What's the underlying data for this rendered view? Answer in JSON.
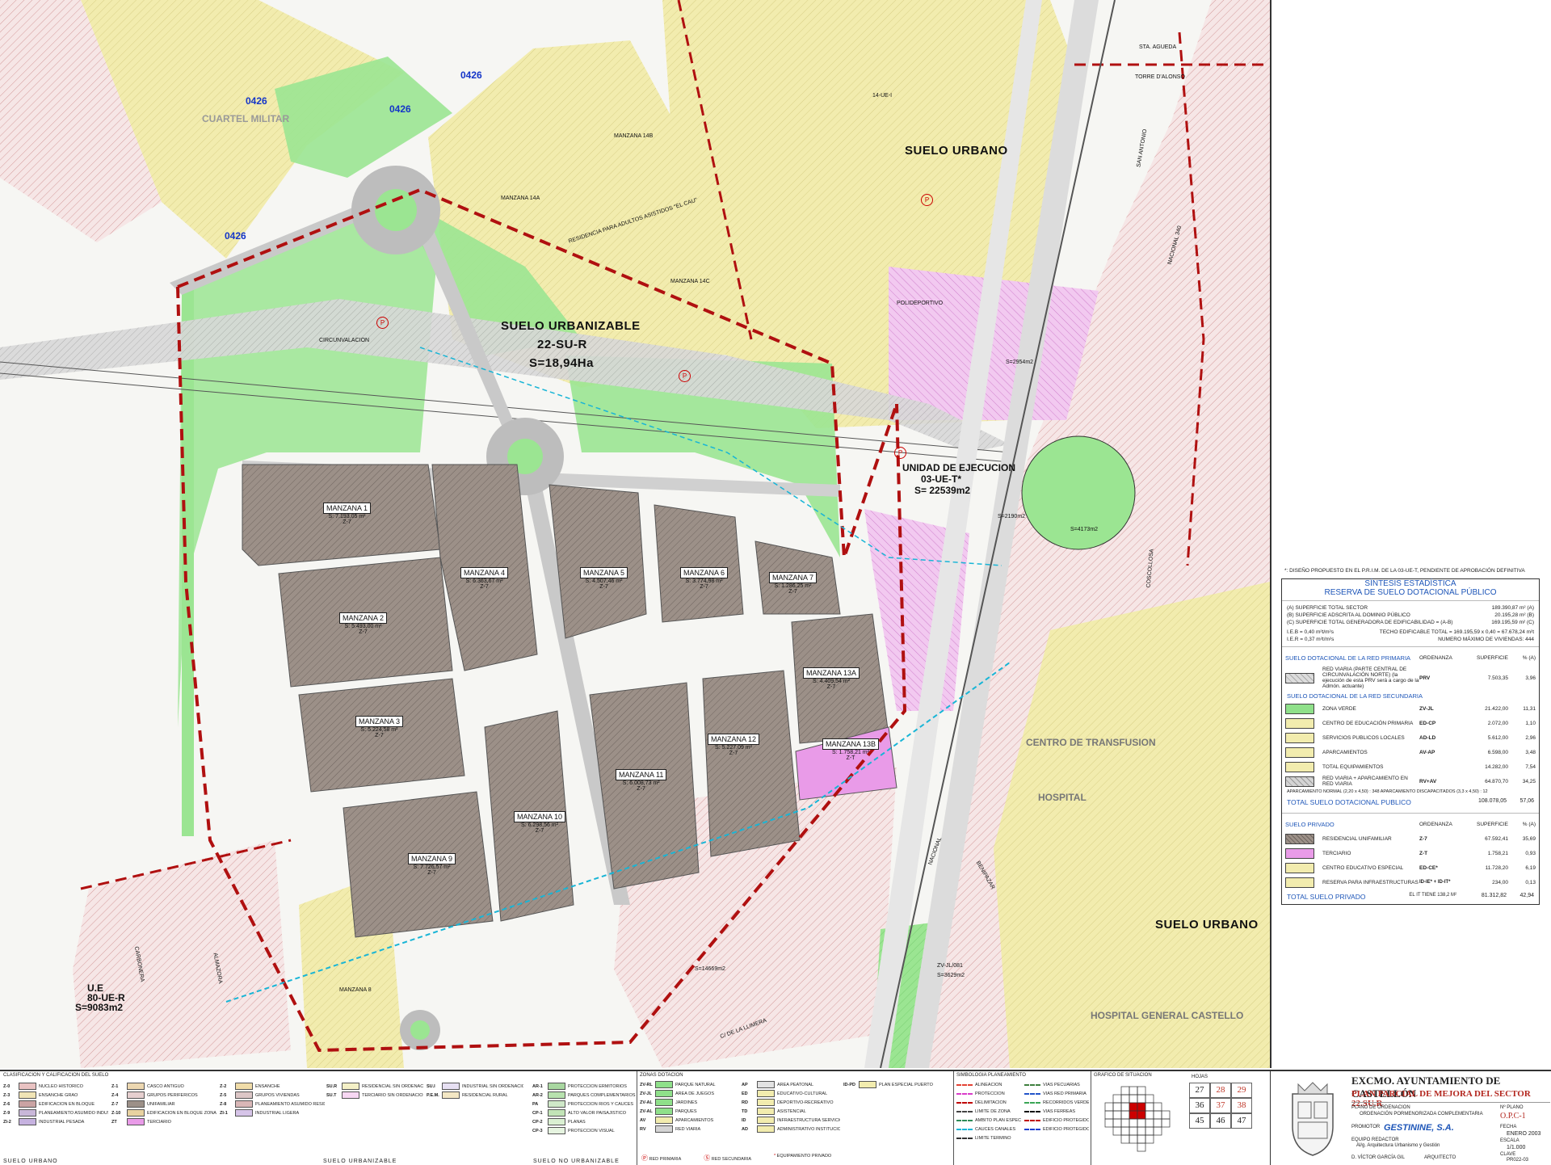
{
  "map": {
    "zone_labels": [
      {
        "text": "SUELO URBANO",
        "cls": "big"
      },
      {
        "text": "SUELO URBANIZABLE",
        "cls": "big"
      },
      {
        "text": "22-SU-R",
        "cls": "big"
      },
      {
        "text": "S=18,94Ha",
        "cls": "big"
      },
      {
        "text": "UNIDAD DE EJECUCION",
        "cls": "med"
      },
      {
        "text": "03-UE-T*",
        "cls": "med"
      },
      {
        "text": "S= 22539m2",
        "cls": "med"
      },
      {
        "text": "SUELO URBANO",
        "cls": "big"
      },
      {
        "text": "U.E",
        "cls": "med"
      },
      {
        "text": "80-UE-R",
        "cls": "med"
      },
      {
        "text": "S=9083m2",
        "cls": "med"
      },
      {
        "text": "CUARTEL MILITAR",
        "cls": "med"
      },
      {
        "text": "CIRCUNVALACION",
        "cls": "small"
      },
      {
        "text": "14-UE-I",
        "cls": "small"
      },
      {
        "text": "POLIDEPORTIVO",
        "cls": "small"
      },
      {
        "text": "CENTRO DE TRANSFUSION",
        "cls": "med"
      },
      {
        "text": "HOSPITAL",
        "cls": "med"
      },
      {
        "text": "HOSPITAL GENERAL CASTELLO",
        "cls": "med"
      },
      {
        "text": "NACIONAL 340",
        "cls": "small"
      },
      {
        "text": "NACIONAL",
        "cls": "small"
      },
      {
        "text": "COSCOLLOSA",
        "cls": "small"
      },
      {
        "text": "BENIPAZAR",
        "cls": "small"
      },
      {
        "text": "C/ DE LA LLIMERA",
        "cls": "small"
      },
      {
        "text": "STA. AGUEDA",
        "cls": "small"
      },
      {
        "text": "TORRE D'ALONSO",
        "cls": "small"
      },
      {
        "text": "SAN ANTONIO",
        "cls": "small"
      },
      {
        "text": "ALMAZORA",
        "cls": "small"
      },
      {
        "text": "CARBONERA",
        "cls": "small"
      },
      {
        "text": "RESIDENCIA PARA ADULTOS ASISTIDOS \"EL CAU\"",
        "cls": "small"
      },
      {
        "text": "MANZANA 14A",
        "cls": "small"
      },
      {
        "text": "MANZANA 14B",
        "cls": "small"
      },
      {
        "text": "MANZANA 14C",
        "cls": "small"
      },
      {
        "text": "MANZANA 8",
        "cls": "small"
      },
      {
        "text": "ZV-JL/081",
        "cls": "small"
      },
      {
        "text": "S=3629m2",
        "cls": "small"
      },
      {
        "text": "S=2954m2",
        "cls": "small"
      },
      {
        "text": "S=4173m2",
        "cls": "small"
      },
      {
        "text": "S=2190m2",
        "cls": "small"
      },
      {
        "text": "S=14669m2",
        "cls": "small"
      }
    ],
    "manzanas": [
      {
        "name": "MANZANA 1",
        "area": "S: 7.193,05 m²",
        "zone": "Z-7"
      },
      {
        "name": "MANZANA 2",
        "area": "S: 5.493,00 m²",
        "zone": "Z-7"
      },
      {
        "name": "MANZANA 3",
        "area": "S: 5.224,58 m²",
        "zone": "Z-7"
      },
      {
        "name": "MANZANA 4",
        "area": "S: 6.363,67 m²",
        "zone": "Z-7"
      },
      {
        "name": "MANZANA 5",
        "area": "S: 4.507,46 m²",
        "zone": "Z-7"
      },
      {
        "name": "MANZANA 6",
        "area": "S: 3.774,98 m²",
        "zone": "Z-7"
      },
      {
        "name": "MANZANA 7",
        "area": "S: 1.286,25 m²",
        "zone": "Z-7"
      },
      {
        "name": "MANZANA 9",
        "area": "S: 7.726,57 m²",
        "zone": "Z-7"
      },
      {
        "name": "MANZANA 10",
        "area": "S: 6.298,56 m²",
        "zone": "Z-7"
      },
      {
        "name": "MANZANA 11",
        "area": "S: 6.008,73 m²",
        "zone": "Z-7"
      },
      {
        "name": "MANZANA 12",
        "area": "S: 5.227,09 m²",
        "zone": "Z-7"
      },
      {
        "name": "MANZANA 13A",
        "area": "S: 4.409,54 m²",
        "zone": "Z-7"
      },
      {
        "name": "MANZANA 13B",
        "area": "S: 1.758,21 m²",
        "zone": "Z-T"
      }
    ],
    "blue_codes": [
      "0426",
      "0426",
      "0426",
      "0426"
    ]
  },
  "legend": {
    "footnote": "*: DISEÑO PROPUESTO EN EL P.R.I.M. DE LA 03-UE-T, PENDIENTE DE APROBACIÓN DEFINITIVA",
    "title1": "SÍNTESIS ESTADÍSTICA",
    "title2": "RESERVA DE SUELO DOTACIONAL PÚBLICO",
    "summary": [
      {
        "label": "(A) SUPERFICIE TOTAL SECTOR",
        "value": "189.390,87 m² (A)"
      },
      {
        "label": "(B) SUPERFICIE ADSCRITA AL DOMINIO PÚBLICO",
        "value": "20.195,28 m² (B)"
      },
      {
        "label": "(C) SUPERFICIE TOTAL GENERADORA DE EDIFICABILIDAD = (A-B)",
        "value": "169.195,59 m² (C)"
      }
    ],
    "indices": [
      {
        "label": "I.E.B = 0,40 m²t/m²s",
        "value": "TECHO EDIFICABLE TOTAL = 169.195,59 x 0,40 = 67.678,24 m²t"
      },
      {
        "label": "I.E.R = 0,37 m²t/m²s",
        "value": "NUMERO MÁXIMO DE VIVIENDAS: 444"
      }
    ],
    "primary_header": "SUELO DOTACIONAL DE LA RED PRIMARIA",
    "col_ordenanza": "ORDENANZA",
    "col_superficie": "SUPERFICIE",
    "col_pct": "% (A)",
    "primary_rows": [
      {
        "name": "RED VIARIA (PARTE CENTRAL DE CIRCUNVALACIÓN NORTE) (la ejecución de esta PRV será a cargo de la Admón. actuante)",
        "code": "PRV",
        "value": "7.503,35",
        "pct": "3,96",
        "color": "#dcdcdc"
      }
    ],
    "secondary_header": "SUELO DOTACIONAL DE LA RED SECUNDARIA",
    "secondary_rows": [
      {
        "name": "ZONA VERDE",
        "code": "ZV-JL",
        "value": "21.422,00",
        "pct": "11,31",
        "color": "#8fe08a"
      },
      {
        "name": "CENTRO DE EDUCACIÓN PRIMARIA",
        "code": "ED-CP",
        "value": "2.072,00",
        "pct": "1,10",
        "color": "#f2ecae"
      },
      {
        "name": "SERVICIOS PUBLICOS LOCALES",
        "code": "AD-LD",
        "value": "5.612,00",
        "pct": "2,96",
        "color": "#f2ecae"
      },
      {
        "name": "APARCAMIENTOS",
        "code": "AV-AP",
        "value": "6.598,00",
        "pct": "3,48",
        "color": "#f2ecae"
      },
      {
        "name": "TOTAL EQUIPAMIENTOS",
        "code": "",
        "value": "14.282,00",
        "pct": "7,54",
        "color": "#f2ecae"
      },
      {
        "name": "RED VIARIA + APARCAMIENTO EN RED VIARIA",
        "code": "RV+AV",
        "value": "64.870,70",
        "pct": "34,25",
        "color": "#d4d4d4"
      }
    ],
    "parking_note": "APARCAMIENTO NORMAL (2,20 x 4,50) : 348    APARCAMIENTO DISCAPACITADOS (3,3 x 4,50) : 12",
    "total_public_label": "TOTAL SUELO DOTACIONAL PUBLICO",
    "total_public_value": "108.078,05",
    "total_public_pct": "57,06",
    "private_header": "SUELO PRIVADO",
    "private_rows": [
      {
        "name": "RESIDENCIAL UNIFAMILIAR",
        "code": "Z-7",
        "value": "67.592,41",
        "pct": "35,69",
        "color": "#9c9088"
      },
      {
        "name": "TERCIARIO",
        "code": "Z-T",
        "value": "1.758,21",
        "pct": "0,93",
        "color": "#e99be8"
      },
      {
        "name": "CENTRO EDUCATIVO ESPECIAL",
        "code": "ED-CE*",
        "value": "11.728,20",
        "pct": "6,19",
        "color": "#f2ecae"
      },
      {
        "name": "RESERVA PARA INFRAESTRUCTURAS",
        "code": "ID-IE* + ID-IT*",
        "value": "234,00",
        "pct": "0,13",
        "color": "#f2ecae"
      }
    ],
    "it_note": "EL IT TIENE 138,2 M²",
    "total_private_label": "TOTAL SUELO PRIVADO",
    "total_private_value": "81.312,82",
    "total_private_pct": "42,94"
  },
  "bottom": {
    "sec1_title": "CLASIFICACION Y CALIFICACION DEL SUELO",
    "sec1_foot1": "SUELO URBANO",
    "sec1_foot2": "SUELO URBANIZABLE",
    "sec1_foot3": "SUELO NO URBANIZABLE",
    "urbano_items": [
      {
        "code": "Z-0",
        "name": "NUCLEO HISTORICO",
        "color": "#e9c2c2"
      },
      {
        "code": "Z-1",
        "name": "CASCO ANTIGUO",
        "color": "#ecd7b0"
      },
      {
        "code": "Z-2",
        "name": "ENSANCHE",
        "color": "#f0dca8"
      },
      {
        "code": "Z-3",
        "name": "ENSANCHE GRAO",
        "color": "#f0e4b5"
      },
      {
        "code": "Z-4",
        "name": "GRUPOS PERIFERICOS",
        "color": "#e6cfcf"
      },
      {
        "code": "Z-5",
        "name": "GRUPOS VIVIENDAS",
        "color": "#dcc6c6"
      },
      {
        "code": "Z-6",
        "name": "EDIFICACION EN BLOQUE",
        "color": "#caa3a3"
      },
      {
        "code": "Z-7",
        "name": "UNIFAMILIAR",
        "color": "#9c9088"
      },
      {
        "code": "Z-8",
        "name": "PLANEAMIENTO ASUMIDO RESIDENCIAL",
        "color": "#d9b7b7"
      },
      {
        "code": "Z-9",
        "name": "PLANEAMIENTO ASUMIDO INDUSTRIAL",
        "color": "#c9b7d9"
      },
      {
        "code": "Z-10",
        "name": "EDIFICACION EN BLOQUE ZONA TURISTICA",
        "color": "#e8d2a0"
      },
      {
        "code": "ZI-1",
        "name": "INDUSTRIAL LIGERA",
        "color": "#d6c4e8"
      },
      {
        "code": "ZI-2",
        "name": "INDUSTRIAL PESADA",
        "color": "#c6b2e0"
      },
      {
        "code": "ZT",
        "name": "TERCIARIO",
        "color": "#e99be8"
      }
    ],
    "urbanizable_items": [
      {
        "code": "SU.R",
        "name": "RESIDENCIAL SIN ORDENACION PORMENORIZADA",
        "color": "#f4f0c6"
      },
      {
        "code": "SU.I",
        "name": "INDUSTRIAL SIN ORDENACION PORMENORIZADA",
        "color": "#e7e0f3"
      },
      {
        "code": "SU.T",
        "name": "TERCIARIO SIN ORDENACION PORMENORIZADA",
        "color": "#f7d7f3"
      },
      {
        "code": "P.E.M.",
        "name": "RESIDENCIAL RURAL",
        "color": "#f3e7c4"
      }
    ],
    "noturb_items": [
      {
        "code": "AR-1",
        "name": "PROTECCION ERMITORIOS",
        "color": "#a8d7a0"
      },
      {
        "code": "AR-2",
        "name": "PARQUES COMPLEMENTARIOS",
        "color": "#b7e2ae"
      },
      {
        "code": "PA",
        "name": "PROTECCION RIOS Y CAUCES",
        "color": "#cfe8c8"
      },
      {
        "code": "CP-1",
        "name": "ALTO VALOR PAISAJISTICO",
        "color": "#c2e4b7"
      },
      {
        "code": "CP-2",
        "name": "PLANAS",
        "color": "#daf0d2"
      },
      {
        "code": "CP-3",
        "name": "PROTECCION VISUAL",
        "color": "#e6f4e0"
      }
    ],
    "sec2_title": "ZONAS DOTACION",
    "dot_items": [
      {
        "code": "ZV-RL",
        "name": "PARQUE NATURAL",
        "color": "#8fe08a"
      },
      {
        "code": "ZV-JL",
        "name": "AREA DE JUEGOS",
        "color": "#8fe08a"
      },
      {
        "code": "ZV-AL",
        "name": "JARDINES",
        "color": "#8fe08a"
      },
      {
        "code": "ZV-AL",
        "name": "PARQUES",
        "color": "#8fe08a"
      },
      {
        "code": "AV",
        "name": "APARCAMIENTOS",
        "color": "#f2ecae"
      },
      {
        "code": "RV",
        "name": "RED VIARIA",
        "color": "#d4d4d4"
      },
      {
        "code": "AP",
        "name": "AREA PEATONAL",
        "color": "#e2e2e2"
      },
      {
        "code": "ED",
        "name": "EDUCATIVO-CULTURAL",
        "color": "#f2ecae"
      },
      {
        "code": "RD",
        "name": "DEPORTIVO-RECREATIVO",
        "color": "#f2ecae"
      },
      {
        "code": "TD",
        "name": "ASISTENCIAL",
        "color": "#f2ecae"
      },
      {
        "code": "ID",
        "name": "INFRAESTRUCTURA SERVICIO URBANO",
        "color": "#f2ecae"
      },
      {
        "code": "AD",
        "name": "ADMINISTRATIVO INSTITUCIONAL",
        "color": "#f2ecae"
      },
      {
        "code": "ID-PD",
        "name": "PLAN ESPECIAL PUERTO",
        "color": "#f2ecae"
      }
    ],
    "sec3_title": "SIMBOLOGIA PLANEAMIENTO",
    "sym_items": [
      {
        "name": "ALINEACION",
        "color": "#e34234"
      },
      {
        "name": "PROTECCION",
        "color": "#d93cc9"
      },
      {
        "name": "DELIMITACION",
        "color": "#c00000"
      },
      {
        "name": "LIMITE DE ZONA",
        "color": "#444444"
      },
      {
        "name": "AMBITO PLAN ESPECIAL PROTEC.",
        "color": "#2e8b57"
      },
      {
        "name": "CAUCES CANALES",
        "color": "#18b5d6"
      },
      {
        "name": "LIMITE TERMINO",
        "color": "#333333"
      },
      {
        "name": "VIAS PECUARIAS",
        "color": "#3f7f3f"
      },
      {
        "name": "VIAS RED PRIMARIA",
        "color": "#2254c9"
      },
      {
        "name": "RECORRIDOS VERDES",
        "color": "#3aa655"
      },
      {
        "name": "VIAS FERREAS",
        "color": "#111111"
      },
      {
        "name": "EDIFICIO PROTEGIDO - C.M.I.",
        "color": "#c00000"
      },
      {
        "name": "EDIFICIO PROTEGIDO - C.S.D.C.",
        "color": "#1e3fd0"
      }
    ],
    "red_primaria": "RED PRIMARIA",
    "red_secundaria": "RED SECUNDARIA",
    "equip_privado": "EQUIPAMIENTO PRIVADO",
    "sec4_title": "GRAFICO DE SITUACION",
    "hojas_label": "HOJAS",
    "hojas": [
      "27",
      "28",
      "29",
      "36",
      "37",
      "38",
      "45",
      "46",
      "47"
    ],
    "hojas_highlight": [
      "28",
      "29",
      "37",
      "38"
    ],
    "ayuntamiento": "EXCMO. AYUNTAMIENTO DE CASTELLÓN",
    "plan_title": "PLAN PARCIAL DE MEJORA DEL SECTOR 22.SU.R",
    "plano_label": "PLANO DE ORDENACION",
    "plano_desc": "ORDENACIÓN PORMENORIZADA COMPLEMENTARIA",
    "plano_no_label": "Nº PLANO",
    "plano_no": "O.P.C-1",
    "promotor_label": "PROMOTOR",
    "promotor": "GESTININE, S.A.",
    "equipo_label": "EQUIPO REDACTOR",
    "equipo": "Al/g. Arquitectura Urbanismo y Gestión",
    "fecha_label": "FECHA",
    "fecha": "ENERO 2003",
    "escala_label": "ESCALA",
    "escala": "1/1.000",
    "clave_label": "CLAVE",
    "clave": "PR022-03",
    "arquitecto": "D. VÍCTOR GARCÍA GIL",
    "arquitecto_label": "ARQUITECTO"
  }
}
